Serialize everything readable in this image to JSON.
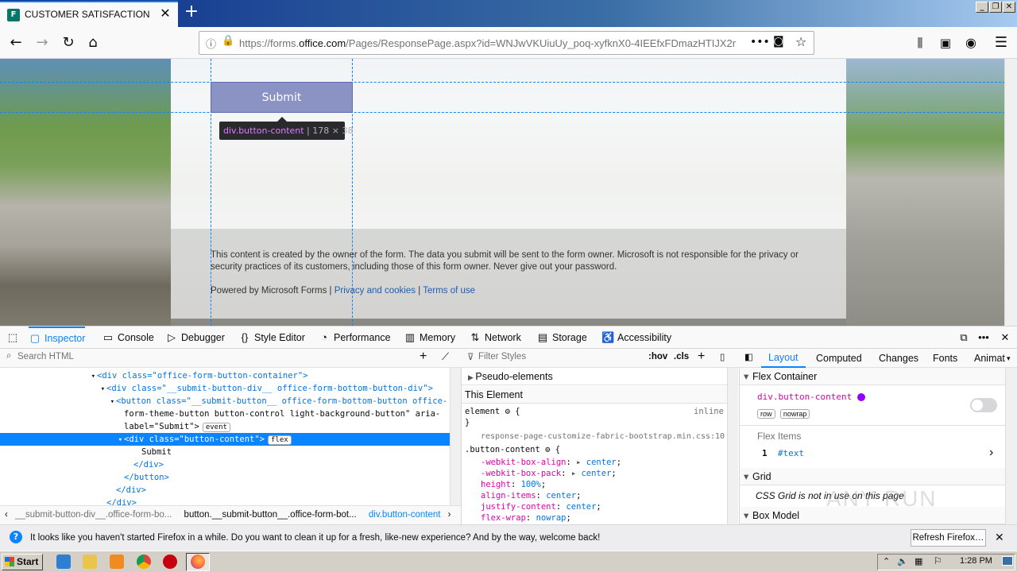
{
  "browser": {
    "tab_title": "CUSTOMER SATISFACTION SURVE",
    "tab_icon": "F",
    "url_prefix": "https://forms.",
    "url_domain": "office.com",
    "url_rest": "/Pages/ResponsePage.aspx?id=WNJwVKUiuUy_poq-xyfknX0-4IEEfxFDmazHTIJX2r"
  },
  "page": {
    "submit_label": "Submit",
    "tooltip_selector": "div.button-content",
    "tooltip_dims": "178 × 38",
    "disclaimer": "This content is created by the owner of the form. The data you submit will be sent to the form owner. Microsoft is not responsible for the privacy or security practices of its customers, including those of this form owner. Never give out your password.",
    "powered_by": "Powered by Microsoft Forms |",
    "privacy_link": "Privacy and cookies",
    "separator": "|",
    "terms_link": "Terms of use"
  },
  "devtools": {
    "tabs": [
      "Inspector",
      "Console",
      "Debugger",
      "Style Editor",
      "Performance",
      "Memory",
      "Network",
      "Storage",
      "Accessibility"
    ],
    "search_placeholder": "Search HTML",
    "filter_placeholder": "Filter Styles",
    "hov": ":hov",
    "cls": ".cls",
    "side_tabs": [
      "Layout",
      "Computed",
      "Changes",
      "Fonts",
      "Animat"
    ],
    "markup": [
      {
        "indent": 122,
        "arrow": "▾",
        "html": "<div class=\"office-form-button-container\">"
      },
      {
        "indent": 134,
        "arrow": "▾",
        "html": "<div class=\"__submit-button-div__ office-form-bottom-button-div\">"
      },
      {
        "indent": 146,
        "arrow": "▾",
        "html": "<button class=\"__submit-button__ office-form-bottom-button office-"
      },
      {
        "indent": 156,
        "arrow": "",
        "html": "form-theme-button button-control light-background-button\" aria-"
      },
      {
        "indent": 156,
        "arrow": "",
        "html": "label=\"Submit\">",
        "badge": "event"
      },
      {
        "indent": 156,
        "arrow": "▾",
        "html": "<div class=\"button-content\">",
        "badge": "flex",
        "selected": true
      },
      {
        "indent": 178,
        "arrow": "",
        "html": "Submit"
      },
      {
        "indent": 168,
        "arrow": "",
        "html": "</div>"
      },
      {
        "indent": 156,
        "arrow": "",
        "html": "</button>"
      },
      {
        "indent": 146,
        "arrow": "",
        "html": "</div>"
      },
      {
        "indent": 134,
        "arrow": "",
        "html": "</div>"
      }
    ],
    "breadcrumbs": [
      "__submit-button-div__.office-form-bo...",
      "button.__submit-button__.office-form-bot...",
      "div.button-content"
    ],
    "rules": {
      "pseudo": "Pseudo-elements",
      "this_element": "This Element",
      "element_label": "element",
      "inline": "inline",
      "source": "response-page-customize-fabric-bootstrap.min.css:10",
      "selector": ".button-content",
      "props": [
        {
          "name": "-webkit-box-align",
          "value": "center"
        },
        {
          "name": "-webkit-box-pack",
          "value": "center"
        },
        {
          "name": "height",
          "value": "100%"
        },
        {
          "name": "align-items",
          "value": "center"
        },
        {
          "name": "justify-content",
          "value": "center"
        },
        {
          "name": "flex-wrap",
          "value": "nowrap"
        }
      ]
    },
    "layout": {
      "flex_container": "Flex Container",
      "flex_selector": "div.button-content",
      "flex_tags": [
        "row",
        "nowrap"
      ],
      "flex_items": "Flex Items",
      "item_index": "1",
      "item_name": "#text",
      "grid": "Grid",
      "grid_note": "CSS Grid is not in use on this page",
      "box_model": "Box Model"
    }
  },
  "notification": {
    "text": "It looks like you haven't started Firefox in a while. Do you want to clean it up for a fresh, like-new experience? And by the way, welcome back!",
    "button": "Refresh Firefox…"
  },
  "taskbar": {
    "start": "Start",
    "clock": "1:28 PM"
  },
  "watermark": "ANY RUN",
  "colors": {
    "accent": "#0a84ff",
    "submit_bg": "#8a93c4",
    "title_bar": "#0b2d8a"
  }
}
